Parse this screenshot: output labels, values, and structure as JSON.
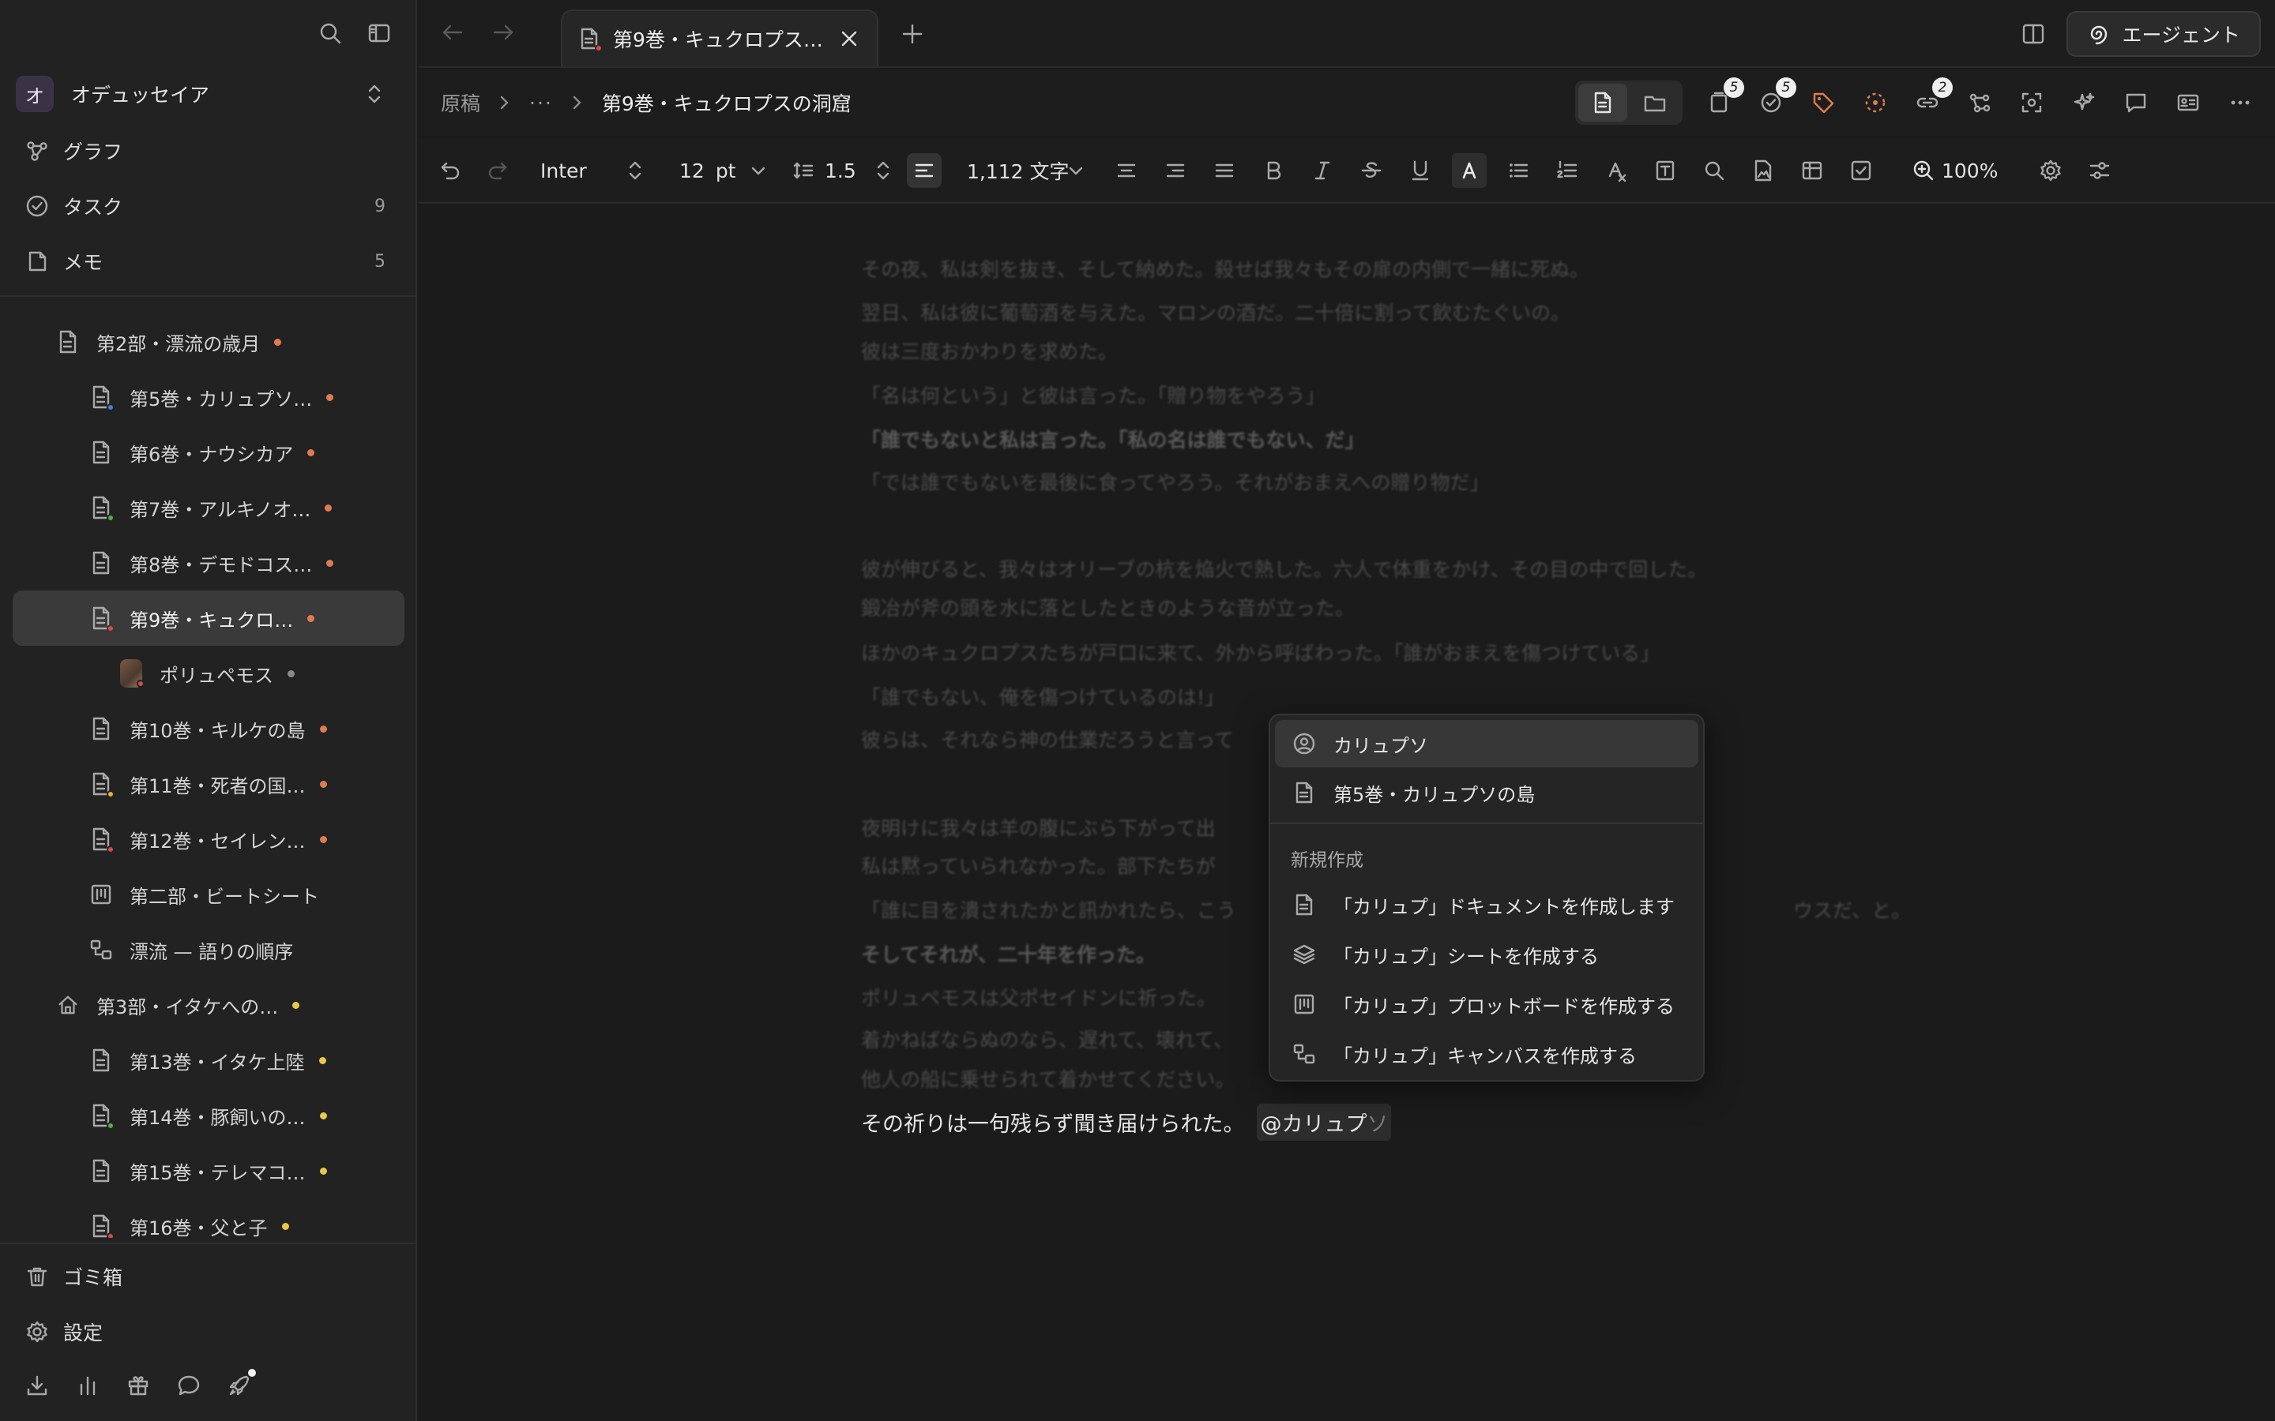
{
  "workspace": {
    "badge": "オ",
    "name": "オデュッセイア"
  },
  "nav": [
    {
      "label": "グラフ",
      "icon": "graph-icon",
      "count": ""
    },
    {
      "label": "タスク",
      "icon": "task-check-icon",
      "count": "9"
    },
    {
      "label": "メモ",
      "icon": "memo-icon",
      "count": "5"
    }
  ],
  "tree": [
    {
      "label": "第2部・漂流の歳月",
      "level": 1,
      "dot": "#e07b50",
      "icon": "doc",
      "mini": ""
    },
    {
      "label": "第5巻・カリュプソ…",
      "level": 2,
      "dot": "#e07b50",
      "icon": "doc",
      "mini": "#4a7fd6"
    },
    {
      "label": "第6巻・ナウシカア",
      "level": 2,
      "dot": "#e07b50",
      "icon": "doc",
      "mini": ""
    },
    {
      "label": "第7巻・アルキノオ…",
      "level": 2,
      "dot": "#e07b50",
      "icon": "doc",
      "mini": "#4caf50"
    },
    {
      "label": "第8巻・デモドコス…",
      "level": 2,
      "dot": "#e07b50",
      "icon": "doc",
      "mini": ""
    },
    {
      "label": "第9巻・キュクロ…",
      "level": 2,
      "dot": "#e07b50",
      "icon": "doc",
      "mini": "#d64a4a",
      "active": true
    },
    {
      "label": "ポリュペモス",
      "level": 3,
      "dot": "#8a8a8a",
      "icon": "avatar",
      "mini": "#d64a4a"
    },
    {
      "label": "第10巻・キルケの島",
      "level": 2,
      "dot": "#e07b50",
      "icon": "doc",
      "mini": ""
    },
    {
      "label": "第11巻・死者の国…",
      "level": 2,
      "dot": "#e07b50",
      "icon": "doc",
      "mini": "#e0b53a"
    },
    {
      "label": "第12巻・セイレン…",
      "level": 2,
      "dot": "#e07b50",
      "icon": "doc",
      "mini": "#d64a4a"
    },
    {
      "label": "第二部・ビートシート",
      "level": 2,
      "dot": "",
      "icon": "board",
      "mini": ""
    },
    {
      "label": "漂流 — 語りの順序",
      "level": 2,
      "dot": "",
      "icon": "canvas",
      "mini": ""
    },
    {
      "label": "第3部・イタケへの…",
      "level": 1,
      "dot": "#e6c84a",
      "icon": "home",
      "mini": ""
    },
    {
      "label": "第13巻・イタケ上陸",
      "level": 2,
      "dot": "#e6c84a",
      "icon": "doc",
      "mini": ""
    },
    {
      "label": "第14巻・豚飼いの…",
      "level": 2,
      "dot": "#e6c84a",
      "icon": "doc",
      "mini": "#4caf50"
    },
    {
      "label": "第15巻・テレマコ…",
      "level": 2,
      "dot": "#e6c84a",
      "icon": "doc",
      "mini": ""
    },
    {
      "label": "第16巻・父と子",
      "level": 2,
      "dot": "#e6c84a",
      "icon": "doc",
      "mini": "#d64a4a"
    }
  ],
  "bottom_nav": [
    {
      "label": "ゴミ箱",
      "icon": "trash-icon"
    },
    {
      "label": "設定",
      "icon": "settings-gear-icon"
    }
  ],
  "tab": {
    "label": "第9巻・キュクロプス…"
  },
  "agent_button": "エージェント",
  "breadcrumb": {
    "root": "原稿",
    "ellipsis": "···",
    "current": "第9巻・キュクロプスの洞窟"
  },
  "tool_badges": {
    "cards": "5",
    "tasks": "5",
    "links": "2"
  },
  "toolbar": {
    "font": "Inter",
    "size": "12",
    "unit": "pt",
    "line_height": "1.5",
    "word_count": "1,112 文字",
    "zoom": "100%"
  },
  "editor": {
    "faded_lines": [
      "その夜、私は剣を抜き、そして納めた。殺せば我々もその扉の内側で一緒に死ぬ。",
      "翌日、私は彼に葡萄酒を与えた。マロンの酒だ。二十倍に割って飲むたぐいの。",
      "彼は三度おかわりを求めた。",
      "「名は何という」と彼は言った。「贈り物をやろう」",
      "「誰でもないと私は言った。「私の名は誰でもない、だ」",
      "「では誰でもないを最後に食ってやろう。それがおまえへの贈り物だ」",
      "彼が伸びると、我々はオリーブの杭を焔火で熱した。六人で体重をかけ、その目の中で回した。",
      "鍛冶が斧の頭を水に落としたときのような音が立った。",
      "ほかのキュクロプスたちが戸口に来て、外から呼ばわった。「誰がおまえを傷つけている」",
      "「誰でもない、俺を傷つけているのは!」",
      "彼らは、それなら神の仕業だろうと言って",
      "夜明けに我々は羊の腹にぶら下がって出",
      "私は黙っていられなかった。部下たちが",
      "「誰に目を潰されたかと訊かれたら、こう",
      "ウスだ、と。",
      "そしてそれが、二十年を作った。",
      "ポリュペモスは父ポセイドンに祈った。",
      "着かねばならぬのなら、遅れて、壊れて、",
      "他人の船に乗せられて着かせてください。"
    ],
    "current_line": "その祈りは一句残らず聞き届けられた。",
    "mention_typed": "@カリュプ",
    "mention_ghost": "ソ"
  },
  "popup": {
    "items": [
      {
        "label": "カリュプソ",
        "icon": "person-icon"
      },
      {
        "label": "第5巻・カリュプソの島",
        "icon": "document-icon"
      }
    ],
    "section": "新規作成",
    "create": [
      {
        "label": "「カリュプ」ドキュメントを作成します",
        "icon": "document-icon"
      },
      {
        "label": "「カリュプ」シートを作成する",
        "icon": "layers-icon"
      },
      {
        "label": "「カリュプ」プロットボードを作成する",
        "icon": "board-icon"
      },
      {
        "label": "「カリュプ」キャンバスを作成する",
        "icon": "canvas-icon"
      }
    ]
  }
}
